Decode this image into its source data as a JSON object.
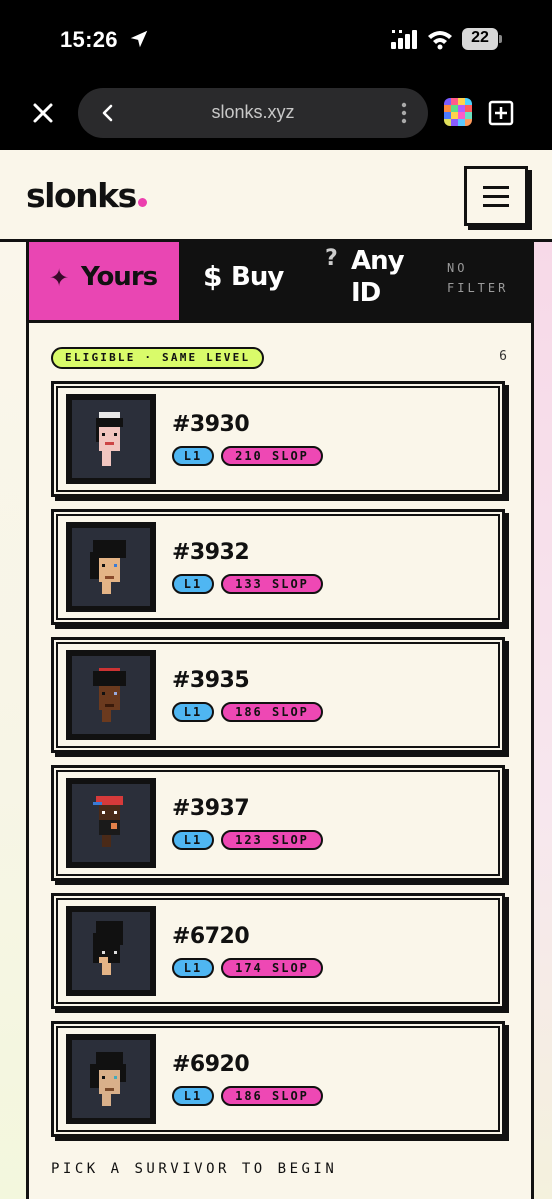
{
  "status_bar": {
    "time": "15:26",
    "battery": "22",
    "icons": [
      "location-arrow-icon",
      "cellular-signal-icon",
      "wifi-icon",
      "battery-icon"
    ]
  },
  "browser": {
    "url": "slonks.xyz",
    "icons": [
      "close-icon",
      "back-chevron-icon",
      "more-vertical-icon",
      "favicon",
      "new-tab-icon"
    ]
  },
  "site": {
    "logo": "slonks",
    "logo_dot_color": "#ec3fae",
    "menu_icon": "hamburger-menu-icon"
  },
  "tabs": {
    "yours": {
      "icon": "sparkle-icon",
      "symbol": "✦",
      "label": "Yours",
      "active": true,
      "color": "#e946b3"
    },
    "buy": {
      "icon": "dollar-icon",
      "symbol": "$",
      "label": "Buy"
    },
    "any": {
      "icon": "question-icon",
      "symbol": "?",
      "label_line1": "Any",
      "label_line2": "ID"
    },
    "no_filter": {
      "line1": "NO",
      "line2": "FILTER"
    }
  },
  "filter_badge": "ELIGIBLE · SAME LEVEL",
  "count": "6",
  "cards": [
    {
      "id": "#3930",
      "level": "L1",
      "slop": "210 SLOP"
    },
    {
      "id": "#3932",
      "level": "L1",
      "slop": "133 SLOP"
    },
    {
      "id": "#3935",
      "level": "L1",
      "slop": "186 SLOP"
    },
    {
      "id": "#3937",
      "level": "L1",
      "slop": "123 SLOP"
    },
    {
      "id": "#6720",
      "level": "L1",
      "slop": "174 SLOP"
    },
    {
      "id": "#6920",
      "level": "L1",
      "slop": "186 SLOP"
    }
  ],
  "pick_prompt": "PICK A SURVIVOR TO BEGIN",
  "colors": {
    "accent_pink": "#e946b3",
    "level_blue": "#4fb6f2",
    "eligible_lime": "#d9fb6a",
    "ink": "#111111",
    "cream": "#faf6ea"
  }
}
